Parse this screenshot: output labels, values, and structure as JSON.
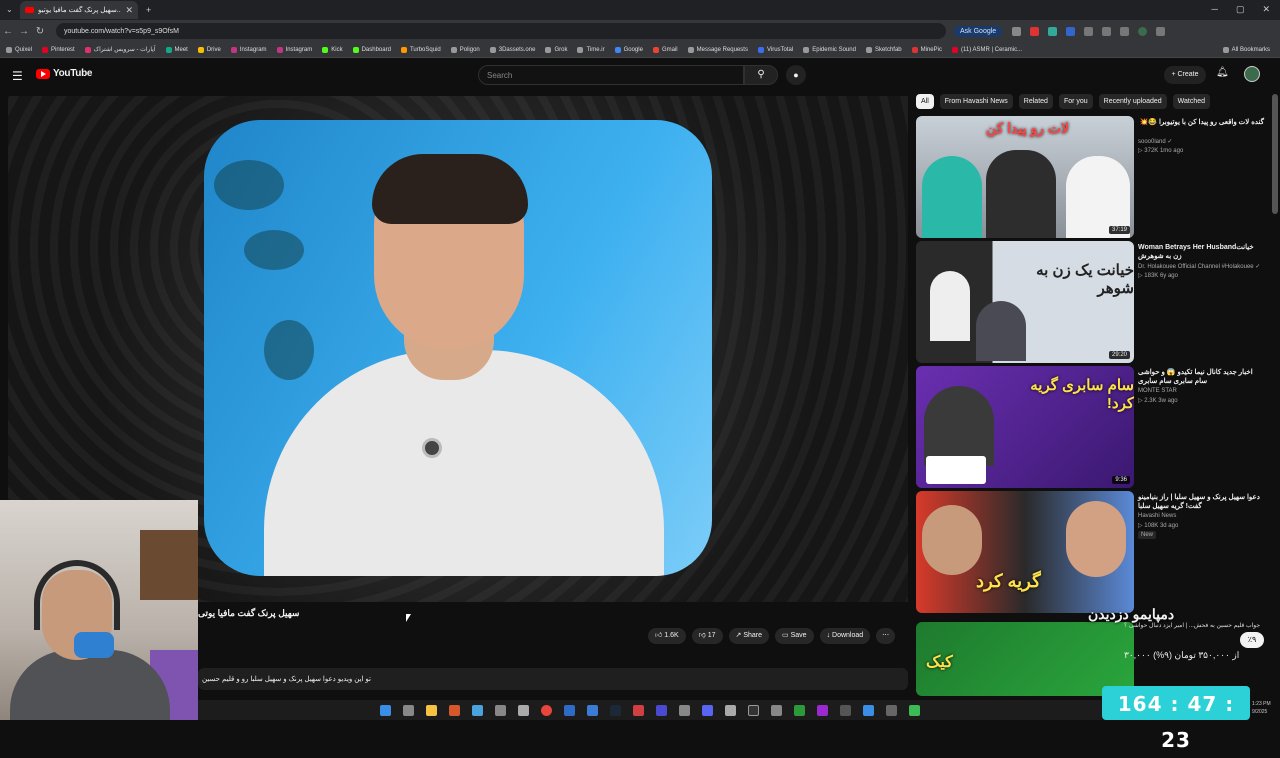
{
  "browser": {
    "tab_title": "سهیل پرنک گفت مافیا یوتیو...",
    "new_tab": "+",
    "url": "youtube.com/watch?v=s5p9_s9OfsM",
    "ask_google": "Ask Google",
    "bookmarks": [
      "Quixel",
      "Pinterest",
      "آپارات - سرویس اشتراک",
      "Meet",
      "Drive",
      "Instagram",
      "Instagram",
      "Kick",
      "Dashboard",
      "TurboSquid",
      "Poligon",
      "3Dassets.one",
      "Grok",
      "Time.ir",
      "Google",
      "Gmail",
      "Message Requests",
      "VirusTotal",
      "Epidemic Sound",
      "Sketchfab",
      "MinePic",
      "(11) ASMR | Ceramic..."
    ],
    "all_bookmarks": "All Bookmarks"
  },
  "youtube": {
    "logo": "YouTube",
    "search_placeholder": "Search",
    "create": "+ Create"
  },
  "video": {
    "title": "سهیل پرنک گفت مافیا یوتی",
    "likes": "1.6K",
    "dislikes": "17",
    "share": "Share",
    "save": "Save",
    "download": "Download",
    "description": "تو این ویدیو دعوا سهیل پرنک و سهیل سلبا رو و قلیم حسین"
  },
  "chips": [
    "All",
    "From Havashi News",
    "Related",
    "For you",
    "Recently uploaded",
    "Watched"
  ],
  "recommendations": [
    {
      "title": "گنده لات واقعی رو پیدا کن با یوتیوبرا 😂💥",
      "channel": "sooo0land ✓",
      "meta": "▷ 372K  1mo ago",
      "duration": "37:19",
      "thumb_text": "لات رو پیدا کن"
    },
    {
      "title": "Woman Betrays Her Husbandخیانت زن به شوهرش",
      "channel": "Dr. Holakouee Official Channel #Holakouee ✓",
      "meta": "▷ 183K  6y ago",
      "duration": "29:20",
      "thumb_text": "خیانت یک زن به شوهر"
    },
    {
      "title": "اخبار جدید کانال نیما تکیدو 😱 و حواشی سام سابری سام سابری",
      "channel": "MONTE STAR",
      "meta": "▷ 2.3K  3w ago",
      "duration": "9:36",
      "thumb_text": "سام سابری گریه کرد!"
    },
    {
      "title": "دعوا سهیل پرنک و سهیل سلبا | راز بنیامینو گفت! گریه سهیل سلبا",
      "channel": "Havashi News",
      "meta": "▷ 108K  3d ago",
      "new_badge": "New",
      "duration": "",
      "thumb_text": "گریه کرد"
    }
  ],
  "overlay": {
    "promo": "دمپایمو دزدیدن",
    "line1": "جواب قلیم حسین به فحش... | امیر ایزد دنبال حواشی ؟",
    "line2": "۳۰,۰۰۰ از ۳۵۰,۰۰۰ تومان (۹%)",
    "percent": "٪۹",
    "timer": "164 : 47 : 23"
  },
  "taskbar": {
    "clock_line1": "1:23 PM",
    "clock_line2": "9/2025"
  }
}
